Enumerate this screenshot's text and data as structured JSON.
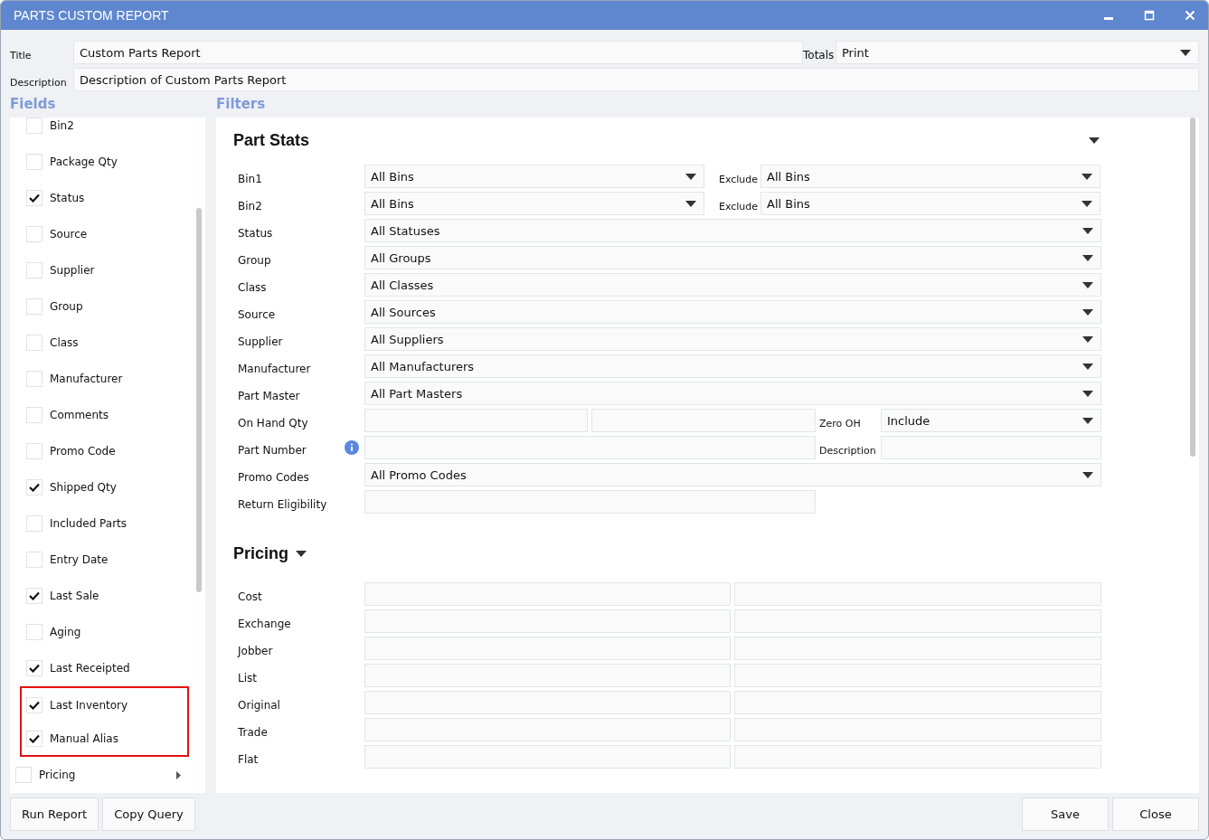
{
  "window": {
    "title": "PARTS CUSTOM REPORT"
  },
  "header": {
    "title_label": "Title",
    "title_value": "Custom Parts Report",
    "totals_label": "Totals",
    "totals_value": "Print",
    "description_label": "Description",
    "description_value": "Description of Custom Parts Report"
  },
  "fields": {
    "heading": "Fields",
    "items": [
      {
        "label": "Bin2",
        "checked": false
      },
      {
        "label": "Package Qty",
        "checked": false
      },
      {
        "label": "Status",
        "checked": true
      },
      {
        "label": "Source",
        "checked": false
      },
      {
        "label": "Supplier",
        "checked": false
      },
      {
        "label": "Group",
        "checked": false
      },
      {
        "label": "Class",
        "checked": false
      },
      {
        "label": "Manufacturer",
        "checked": false
      },
      {
        "label": "Comments",
        "checked": false
      },
      {
        "label": "Promo Code",
        "checked": false
      },
      {
        "label": "Shipped Qty",
        "checked": true
      },
      {
        "label": "Included Parts",
        "checked": false
      },
      {
        "label": "Entry Date",
        "checked": false
      },
      {
        "label": "Last Sale",
        "checked": true
      },
      {
        "label": "Aging",
        "checked": false
      },
      {
        "label": "Last Receipted",
        "checked": true
      }
    ],
    "highlighted_items": [
      {
        "label": "Last Inventory",
        "checked": true
      },
      {
        "label": "Manual Alias",
        "checked": true
      }
    ],
    "groups": [
      {
        "label": "Pricing",
        "checked": false,
        "expanded": false
      }
    ]
  },
  "filters": {
    "heading": "Filters",
    "part_stats": {
      "title": "Part Stats",
      "expanded": true,
      "rows": [
        {
          "kind": "select_exclude",
          "label": "Bin1",
          "value": "All Bins",
          "extra_label": "Exclude",
          "extra_value": "All Bins"
        },
        {
          "kind": "select_exclude",
          "label": "Bin2",
          "value": "All Bins",
          "extra_label": "Exclude",
          "extra_value": "All Bins"
        },
        {
          "kind": "select",
          "label": "Status",
          "value": "All Statuses"
        },
        {
          "kind": "select",
          "label": "Group",
          "value": "All Groups"
        },
        {
          "kind": "select",
          "label": "Class",
          "value": "All Classes"
        },
        {
          "kind": "select",
          "label": "Source",
          "value": "All Sources"
        },
        {
          "kind": "select",
          "label": "Supplier",
          "value": "All Suppliers"
        },
        {
          "kind": "select",
          "label": "Manufacturer",
          "value": "All Manufacturers"
        },
        {
          "kind": "select",
          "label": "Part Master",
          "value": "All Part Masters"
        },
        {
          "kind": "range_select",
          "label": "On Hand Qty",
          "extra_label": "Zero OH",
          "extra_value": "Include"
        },
        {
          "kind": "text_info",
          "label": "Part Number",
          "extra_label": "Description"
        },
        {
          "kind": "select",
          "label": "Promo Codes",
          "value": "All Promo Codes"
        },
        {
          "kind": "short_text",
          "label": "Return Eligibility"
        }
      ]
    },
    "pricing": {
      "title": "Pricing",
      "expanded": true,
      "rows": [
        {
          "label": "Cost"
        },
        {
          "label": "Exchange"
        },
        {
          "label": "Jobber"
        },
        {
          "label": "List"
        },
        {
          "label": "Original"
        },
        {
          "label": "Trade"
        },
        {
          "label": "Flat"
        }
      ]
    }
  },
  "buttons_left": [
    "Run Report",
    "Copy Query"
  ],
  "buttons_right": [
    "Save",
    "Close"
  ]
}
